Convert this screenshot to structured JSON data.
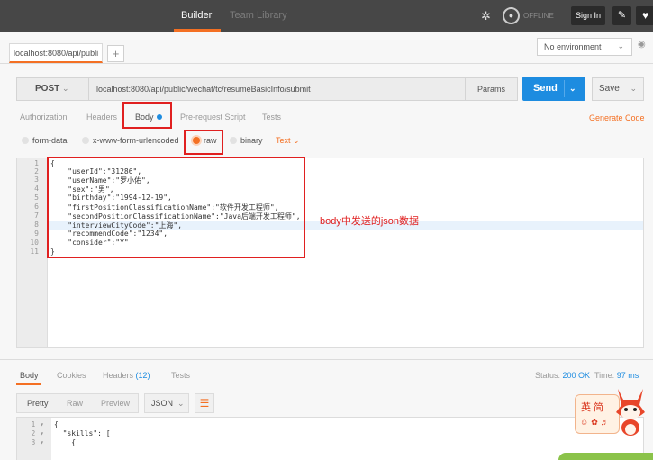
{
  "topbar": {
    "builder": "Builder",
    "team_library": "Team Library",
    "offline": "OFFLINE",
    "sign_in": "Sign In"
  },
  "tabs": {
    "request_tab": "localhost:8080/api/publi",
    "add": "+"
  },
  "environment": {
    "selected": "No environment"
  },
  "request": {
    "method": "POST",
    "url": "localhost:8080/api/public/wechat/tc/resumeBasicInfo/submit",
    "params": "Params",
    "send": "Send",
    "save": "Save"
  },
  "subtabs": {
    "authorization": "Authorization",
    "headers": "Headers",
    "body": "Body",
    "pre_request": "Pre-request Script",
    "tests": "Tests",
    "generate_code": "Generate Code"
  },
  "body_types": {
    "form_data": "form-data",
    "urlencoded": "x-www-form-urlencoded",
    "raw": "raw",
    "binary": "binary",
    "selected": "raw",
    "text_type": "Text"
  },
  "editor": {
    "line_numbers": [
      "1",
      "2",
      "3",
      "4",
      "5",
      "6",
      "7",
      "8",
      "9",
      "10",
      "11"
    ],
    "lines": [
      "{",
      "    \"userId\":\"31286\",",
      "    \"userName\":\"罗小佑\",",
      "    \"sex\":\"男\",",
      "    \"birthday\":\"1994-12-19\",",
      "    \"firstPositionClassificationName\":\"软件开发工程师\",",
      "    \"secondPositionClassificationName\":\"Java后端开发工程师\",",
      "    \"interviewCityCode\":\"上海\",",
      "    \"recommendCode\":\"1234\",",
      "    \"consider\":\"Y\"",
      "}"
    ],
    "active_line": 8,
    "annotation": "body中发送的json数据"
  },
  "response": {
    "tabs": {
      "body": "Body",
      "cookies": "Cookies",
      "headers": "Headers",
      "headers_count": "(12)",
      "tests": "Tests"
    },
    "status_label": "Status:",
    "status_value": "200 OK",
    "time_label": "Time:",
    "time_value": "97 ms",
    "view_modes": {
      "pretty": "Pretty",
      "raw": "Raw",
      "preview": "Preview"
    },
    "format": "JSON",
    "line_numbers": [
      "1 ▾",
      "2 ▾",
      "3 ▾"
    ],
    "lines": [
      "{",
      "  \"skills\": [",
      "    {"
    ]
  },
  "mascot": {
    "label": "英 简"
  },
  "colors": {
    "accent": "#f47023",
    "send": "#1d8ce0",
    "highlight": "#e02020",
    "topbar": "#474747"
  }
}
